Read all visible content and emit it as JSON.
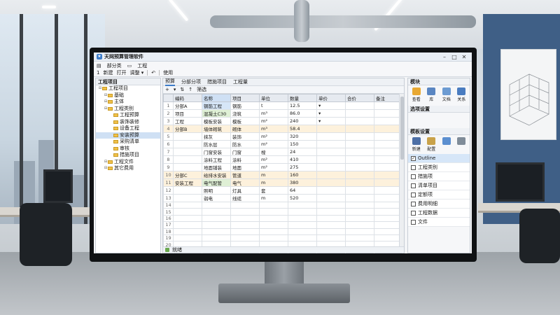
{
  "app": {
    "title": "天网预算管理软件",
    "window_controls": {
      "minimize": "–",
      "maximize": "□",
      "close": "✕"
    }
  },
  "menu": {
    "items": [
      "部分类",
      "工程"
    ],
    "icons": [
      "menu-icon",
      "folder-icon"
    ]
  },
  "toolbar": {
    "items": [
      "1",
      "新建",
      "打开",
      "调整 ▾",
      "↶",
      "使用"
    ]
  },
  "tree": {
    "header": "工程项目",
    "items": [
      {
        "label": "工程项目",
        "level": 0,
        "selected": false
      },
      {
        "label": "基础",
        "level": 1,
        "selected": false
      },
      {
        "label": "主体",
        "level": 1,
        "selected": false
      },
      {
        "label": "工程类别",
        "level": 1,
        "selected": false
      },
      {
        "label": "工程预算",
        "level": 2,
        "selected": false
      },
      {
        "label": "装饰装修",
        "level": 2,
        "selected": false
      },
      {
        "label": "设备工程",
        "level": 2,
        "selected": false
      },
      {
        "label": "安装预算",
        "level": 2,
        "selected": true
      },
      {
        "label": "采购清单",
        "level": 2,
        "selected": false
      },
      {
        "label": "审核",
        "level": 2,
        "selected": false
      },
      {
        "label": "措施项目",
        "level": 2,
        "selected": false
      },
      {
        "label": "工程文件",
        "level": 1,
        "selected": false
      },
      {
        "label": "其它费用",
        "level": 1,
        "selected": false
      }
    ]
  },
  "center": {
    "tabs": [
      "预算",
      "分部分项",
      "措施项目",
      "工程量"
    ],
    "grid_toolbar": [
      "+",
      "▾",
      "⇅",
      "↑",
      "筛选"
    ],
    "columns": [
      "",
      "编码",
      "名称",
      "项目",
      "单位",
      "数量",
      "单价",
      "合价",
      "备注"
    ],
    "rows": [
      [
        "1",
        "分部A",
        "钢筋工程",
        "钢筋",
        "t",
        "12.5",
        "▾",
        "",
        ""
      ],
      [
        "2",
        "项目",
        "混凝土C30",
        "浇筑",
        "m³",
        "86.0",
        "▾",
        "",
        ""
      ],
      [
        "3",
        "工程",
        "模板安装",
        "模板",
        "m²",
        "240",
        "▾",
        "",
        ""
      ],
      [
        "4",
        "分部B",
        "墙体砌筑",
        "砌体",
        "m³",
        "58.4",
        "",
        "",
        ""
      ],
      [
        "5",
        "",
        "抹灰",
        "装饰",
        "m²",
        "320",
        "",
        "",
        ""
      ],
      [
        "6",
        "",
        "防水层",
        "防水",
        "m²",
        "150",
        "",
        "",
        ""
      ],
      [
        "7",
        "",
        "门窗安装",
        "门窗",
        "樘",
        "24",
        "",
        "",
        ""
      ],
      [
        "8",
        "",
        "涂料工程",
        "涂料",
        "m²",
        "410",
        "",
        "",
        ""
      ],
      [
        "9",
        "",
        "地面铺装",
        "地面",
        "m²",
        "275",
        "",
        "",
        ""
      ],
      [
        "10",
        "分部C",
        "给排水安装",
        "管道",
        "m",
        "160",
        "",
        "",
        ""
      ],
      [
        "11",
        "安装工程",
        "电气配管",
        "电气",
        "m",
        "380",
        "",
        "",
        ""
      ],
      [
        "12",
        "",
        "照明",
        "灯具",
        "套",
        "64",
        "",
        "",
        ""
      ],
      [
        "13",
        "",
        "弱电",
        "线缆",
        "m",
        "520",
        "",
        "",
        ""
      ],
      [
        "14",
        "",
        "",
        "",
        "",
        "",
        "",
        "",
        ""
      ],
      [
        "15",
        "",
        "",
        "",
        "",
        "",
        "",
        "",
        ""
      ],
      [
        "16",
        "",
        "",
        "",
        "",
        "",
        "",
        "",
        ""
      ],
      [
        "17",
        "",
        "",
        "",
        "",
        "",
        "",
        "",
        ""
      ],
      [
        "18",
        "",
        "",
        "",
        "",
        "",
        "",
        "",
        ""
      ],
      [
        "19",
        "",
        "",
        "",
        "",
        "",
        "",
        "",
        ""
      ],
      [
        "20",
        "",
        "",
        "",
        "",
        "",
        "",
        "",
        ""
      ],
      [
        "21",
        "",
        "",
        "",
        "",
        "",
        "",
        "",
        ""
      ],
      [
        "22",
        "",
        "",
        "",
        "",
        "",
        "",
        "",
        ""
      ]
    ],
    "highlighted_rows": [
      3,
      9,
      10
    ],
    "status": "就绪"
  },
  "right_panel": {
    "top_header": "模块",
    "top_icons": [
      {
        "label": "查看",
        "icon": "star-icon",
        "color": "#e8a832"
      },
      {
        "label": "库",
        "icon": "book-icon",
        "color": "#5a86c2"
      },
      {
        "label": "文档",
        "icon": "document-icon",
        "color": "#6c9bd2"
      },
      {
        "label": "关系",
        "icon": "chart-icon",
        "color": "#4a7cc0"
      }
    ],
    "mid_header": "选项设置",
    "lower_header": "模板设置",
    "lower_icons": [
      {
        "label": "新建",
        "icon": "save-icon",
        "color": "#4d6fa6"
      },
      {
        "label": "配置",
        "icon": "settings-icon",
        "color": "#c9a24a"
      },
      {
        "label": "",
        "icon": "mail-icon",
        "color": "#5b8fd0"
      },
      {
        "label": "",
        "icon": "print-icon",
        "color": "#7f8c99"
      }
    ],
    "checklist": [
      {
        "label": "Outline",
        "checked": true,
        "selected": true
      },
      {
        "label": "工程类别",
        "checked": false,
        "selected": false
      },
      {
        "label": "措施项",
        "checked": false,
        "selected": false
      },
      {
        "label": "清单项目",
        "checked": false,
        "selected": false
      },
      {
        "label": "定额项",
        "checked": false,
        "selected": false
      },
      {
        "label": "费用明细",
        "checked": false,
        "selected": false
      },
      {
        "label": "工程数据",
        "checked": false,
        "selected": false
      },
      {
        "label": "文件",
        "checked": false,
        "selected": false
      }
    ]
  }
}
